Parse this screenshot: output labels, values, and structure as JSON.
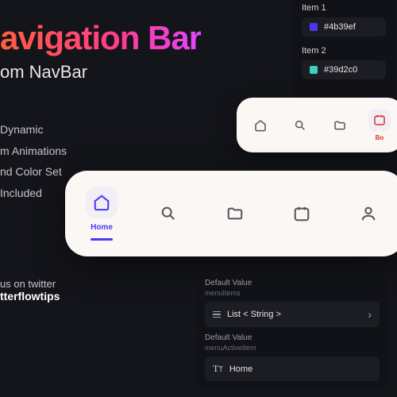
{
  "header": {
    "title": "avigation Bar",
    "subtitle": "om NavBar"
  },
  "features": {
    "f1": "Dynamic",
    "f2": "m Animations",
    "f3": "nd Color Set",
    "f4": "Included"
  },
  "social": {
    "line1": "us on twitter",
    "handle": "tterflowtips"
  },
  "colors": {
    "item1_label": "Item 1",
    "item1_value": "#4b39ef",
    "item2_label": "Item 2",
    "item2_value": "#39d2c0"
  },
  "navbar": {
    "home_label": "Home",
    "small_active_label": "Bo"
  },
  "props": {
    "default_value": "Default Value",
    "menu_items": "menuItems",
    "menu_active": "menuActiveItem",
    "list_label": "List < String >",
    "home_value": "Home"
  }
}
